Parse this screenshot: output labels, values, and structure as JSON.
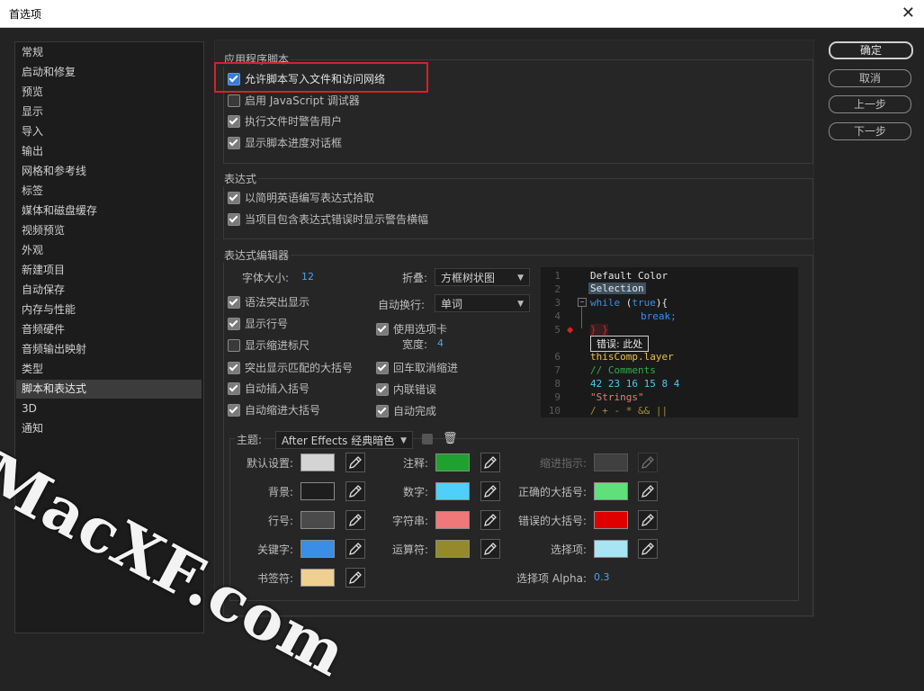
{
  "window": {
    "title": "首选项"
  },
  "sidebar": {
    "items": [
      {
        "label": "常规"
      },
      {
        "label": "启动和修复"
      },
      {
        "label": "预览"
      },
      {
        "label": "显示"
      },
      {
        "label": "导入"
      },
      {
        "label": "输出"
      },
      {
        "label": "网格和参考线"
      },
      {
        "label": "标签"
      },
      {
        "label": "媒体和磁盘缓存"
      },
      {
        "label": "视频预览"
      },
      {
        "label": "外观"
      },
      {
        "label": "新建项目"
      },
      {
        "label": "自动保存"
      },
      {
        "label": "内存与性能"
      },
      {
        "label": "音频硬件"
      },
      {
        "label": "音频输出映射"
      },
      {
        "label": "类型"
      },
      {
        "label": "脚本和表达式"
      },
      {
        "label": "3D"
      },
      {
        "label": "通知"
      }
    ],
    "selected_index": 17
  },
  "buttons": {
    "ok": "确定",
    "cancel": "取消",
    "prev": "上一步",
    "next": "下一步"
  },
  "scripting": {
    "title": "应用程序脚本",
    "allow_write": {
      "label": "允许脚本写入文件和访问网络",
      "checked": true
    },
    "js_debugger": {
      "label": "启用 JavaScript 调试器",
      "checked": false
    },
    "warn_on_run": {
      "label": "执行文件时警告用户",
      "checked": true
    },
    "progress_dialog": {
      "label": "显示脚本进度对话框",
      "checked": true
    }
  },
  "expressions": {
    "title": "表达式",
    "english_pick": {
      "label": "以简明英语编写表达式拾取",
      "checked": true
    },
    "error_banner": {
      "label": "当项目包含表达式错误时显示警告横幅",
      "checked": true
    }
  },
  "editor": {
    "title": "表达式编辑器",
    "font_size_label": "字体大小:",
    "font_size_value": "12",
    "fold_label": "折叠:",
    "fold_value": "方框树状图",
    "wrap_label": "自动换行:",
    "wrap_value": "单词",
    "syntax": {
      "label": "语法突出显示",
      "checked": true
    },
    "line_numbers": {
      "label": "显示行号",
      "checked": true
    },
    "indent_ruler": {
      "label": "显示缩进标尺",
      "checked": false
    },
    "match_braces": {
      "label": "突出显示匹配的大括号",
      "checked": true
    },
    "auto_paren": {
      "label": "自动插入括号",
      "checked": true
    },
    "auto_indent": {
      "label": "自动缩进大括号",
      "checked": true
    },
    "use_tabs": {
      "label": "使用选项卡",
      "checked": true
    },
    "width_label": "宽度:",
    "width_value": "4",
    "enter_cancel": {
      "label": "回车取消缩进",
      "checked": true
    },
    "inline_errors": {
      "label": "内联错误",
      "checked": true
    },
    "auto_complete": {
      "label": "自动完成",
      "checked": true
    }
  },
  "code_preview": {
    "line_numbers": [
      "1",
      "2",
      "3",
      "4",
      "5",
      "6",
      "7",
      "8",
      "9",
      "10"
    ],
    "lines": {
      "l1": "Default Color",
      "l2": "Selection",
      "l3a": "while",
      "l3b": " (",
      "l3c": "true",
      "l3d": "){",
      "l4": "break;",
      "l5": "} }",
      "err": "错误: 此处",
      "l6": "thisComp.layer",
      "l7": "// Comments",
      "l8": "42 23 16 15 8 4",
      "l9": "\"Strings\"",
      "l10": "/ + - * && ||"
    },
    "colors": {
      "default": "#e6e6e6",
      "keyword": "#3b8fe8",
      "comment": "#2fae4a",
      "number": "#4fc8f0",
      "string": "#f07878",
      "operator": "#a0902e"
    }
  },
  "theme": {
    "label": "主题:",
    "value": "After Effects 经典暗色",
    "colors": {
      "default": {
        "label": "默认设置:",
        "hex": "#d4d4d4"
      },
      "background": {
        "label": "背景:",
        "hex": "#1e1e1e"
      },
      "line_number": {
        "label": "行号:",
        "hex": "#4a4a4a"
      },
      "keyword": {
        "label": "关键字:",
        "hex": "#3a8ee6"
      },
      "comment_note": {
        "label": "注释:",
        "hex": "#1ea12e"
      },
      "number": {
        "label": "数字:",
        "hex": "#4fd0fa"
      },
      "string": {
        "label": "字符串:",
        "hex": "#f07878"
      },
      "operator": {
        "label": "运算符:",
        "hex": "#948a2c"
      },
      "indent_guide": {
        "label": "缩进指示:",
        "hex": "#404040"
      },
      "correct_brace": {
        "label": "正确的大括号:",
        "hex": "#5fe07a"
      },
      "wrong_brace": {
        "label": "错误的大括号:",
        "hex": "#e00000"
      },
      "selection": {
        "label": "选择项:",
        "hex": "#a8e4f4"
      },
      "bookmark_label": "书签符:",
      "bookmark_hex": "#f0d090",
      "selection_alpha_label": "选择项 Alpha:",
      "selection_alpha_value": "0.3"
    }
  },
  "watermark": "MacXF.com"
}
